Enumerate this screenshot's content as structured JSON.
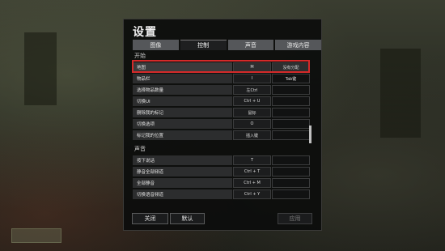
{
  "dialog": {
    "title": "设置",
    "tabs": [
      {
        "label": "图像",
        "active": false
      },
      {
        "label": "控制",
        "active": true
      },
      {
        "label": "声音",
        "active": false
      },
      {
        "label": "游戏内容",
        "active": false
      }
    ]
  },
  "sections": {
    "general": {
      "header": "开始",
      "rows": [
        {
          "label": "地图",
          "key1": "M",
          "key2": "没有分配",
          "highlighted": true
        },
        {
          "label": "物品栏",
          "key1": "I",
          "key2": "Tab键"
        },
        {
          "label": "选择物品数量",
          "key1": "左Ctrl",
          "key2": ""
        },
        {
          "label": "切换UI",
          "key1": "Ctrl + U",
          "key2": ""
        },
        {
          "label": "删除我的标记",
          "key1": "鼠标",
          "key2": ""
        },
        {
          "label": "切换选项",
          "key1": "O",
          "key2": ""
        },
        {
          "label": "标记我的位置",
          "key1": "插入键",
          "key2": ""
        }
      ]
    },
    "sound": {
      "header": "声音",
      "rows": [
        {
          "label": "按下说话",
          "key1": "T",
          "key2": ""
        },
        {
          "label": "静音全部频道",
          "key1": "Ctrl + T",
          "key2": ""
        },
        {
          "label": "全部静音",
          "key1": "Ctrl + M",
          "key2": ""
        },
        {
          "label": "切换语音频道",
          "key1": "Ctrl + Y",
          "key2": ""
        }
      ]
    }
  },
  "footer": {
    "close_label": "关闭",
    "default_label": "默认",
    "apply_label": "应用"
  },
  "colors": {
    "highlight": "#d42a2a"
  }
}
